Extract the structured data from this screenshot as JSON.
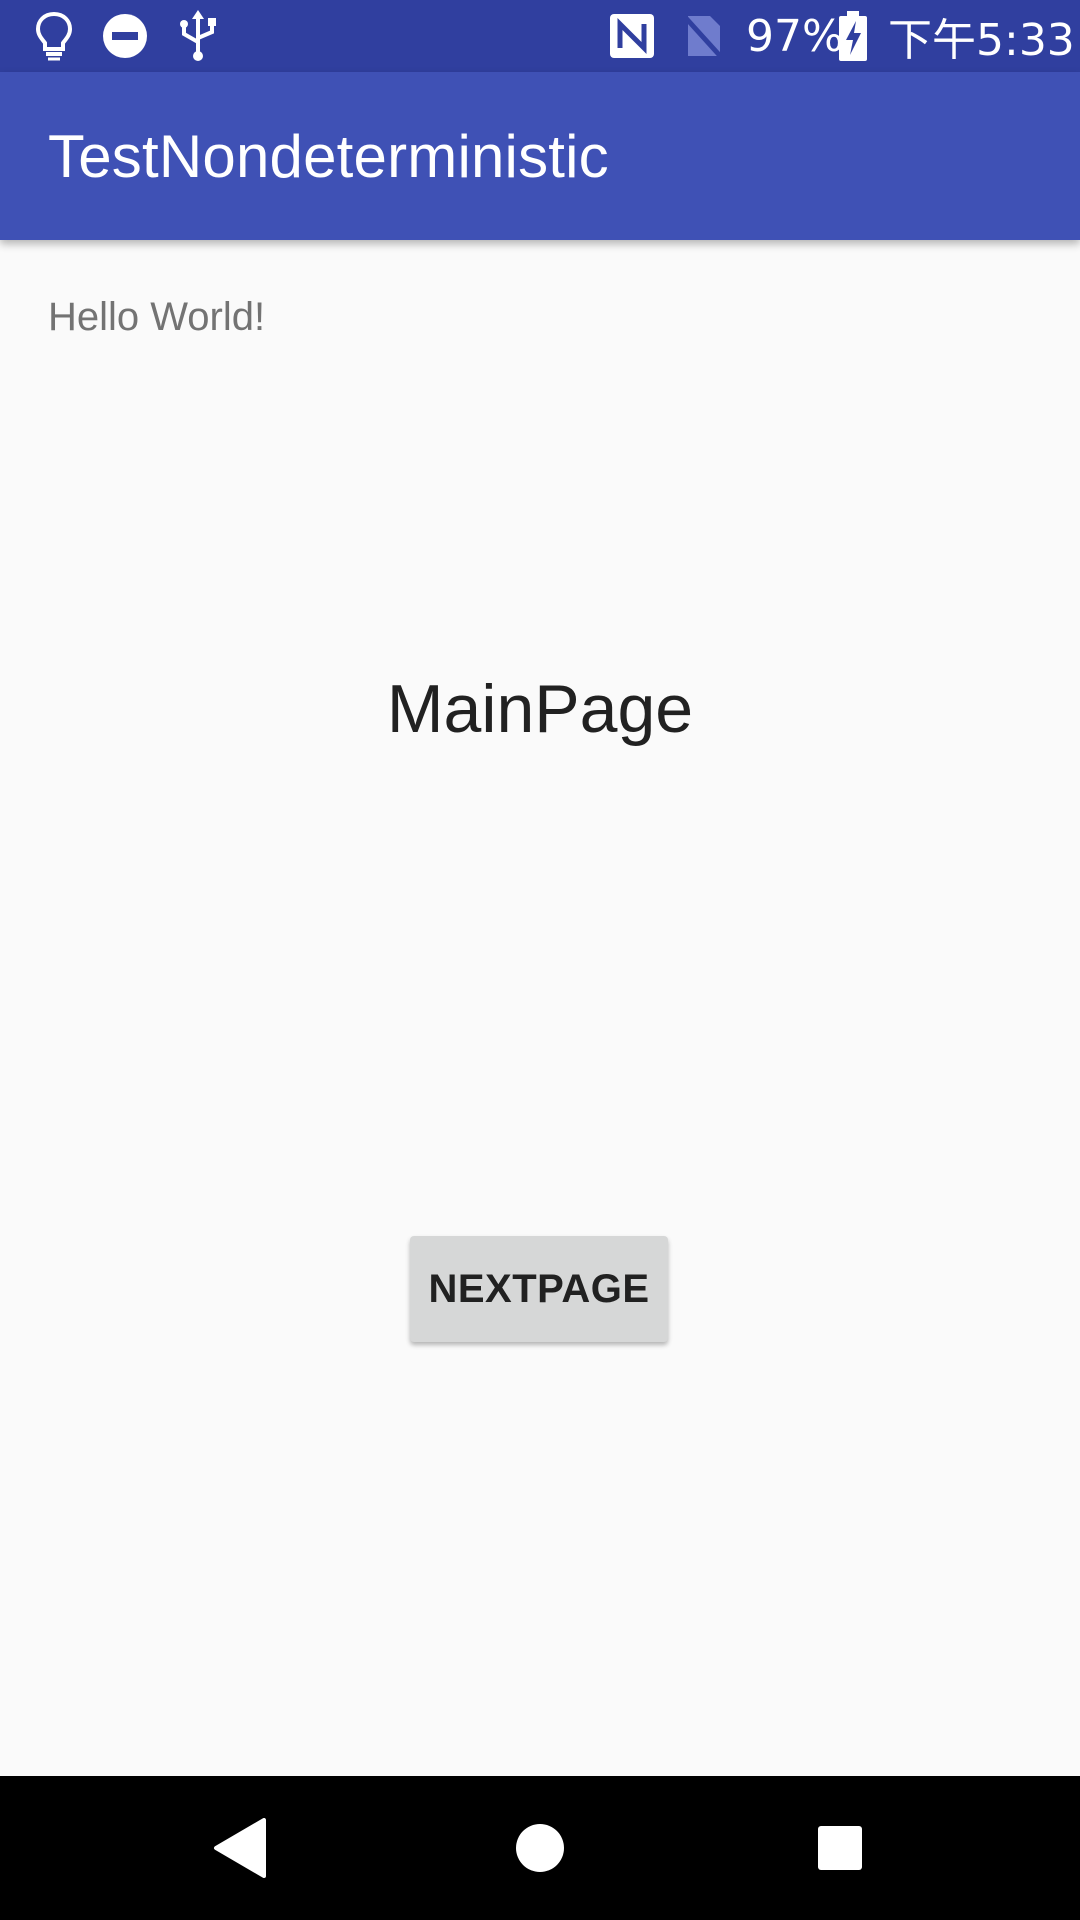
{
  "status_bar": {
    "battery_text": "97%",
    "time": "下午5:33",
    "icons": [
      "lightbulb-icon",
      "do-not-disturb-icon",
      "usb-icon",
      "nfc-icon",
      "no-sim-icon",
      "battery-charging-icon"
    ]
  },
  "app_bar": {
    "title": "TestNondeterministic",
    "color": "#3f51b5"
  },
  "content": {
    "hello": "Hello World!",
    "main_label": "MainPage",
    "next_button_label": "NEXTPAGE"
  },
  "nav_bar": {
    "buttons": [
      "back-icon",
      "home-icon",
      "recents-icon"
    ]
  },
  "colors": {
    "status_bar": "#303f9f",
    "app_bar": "#3f51b5",
    "background": "#fafafa",
    "button": "#d6d7d7"
  }
}
